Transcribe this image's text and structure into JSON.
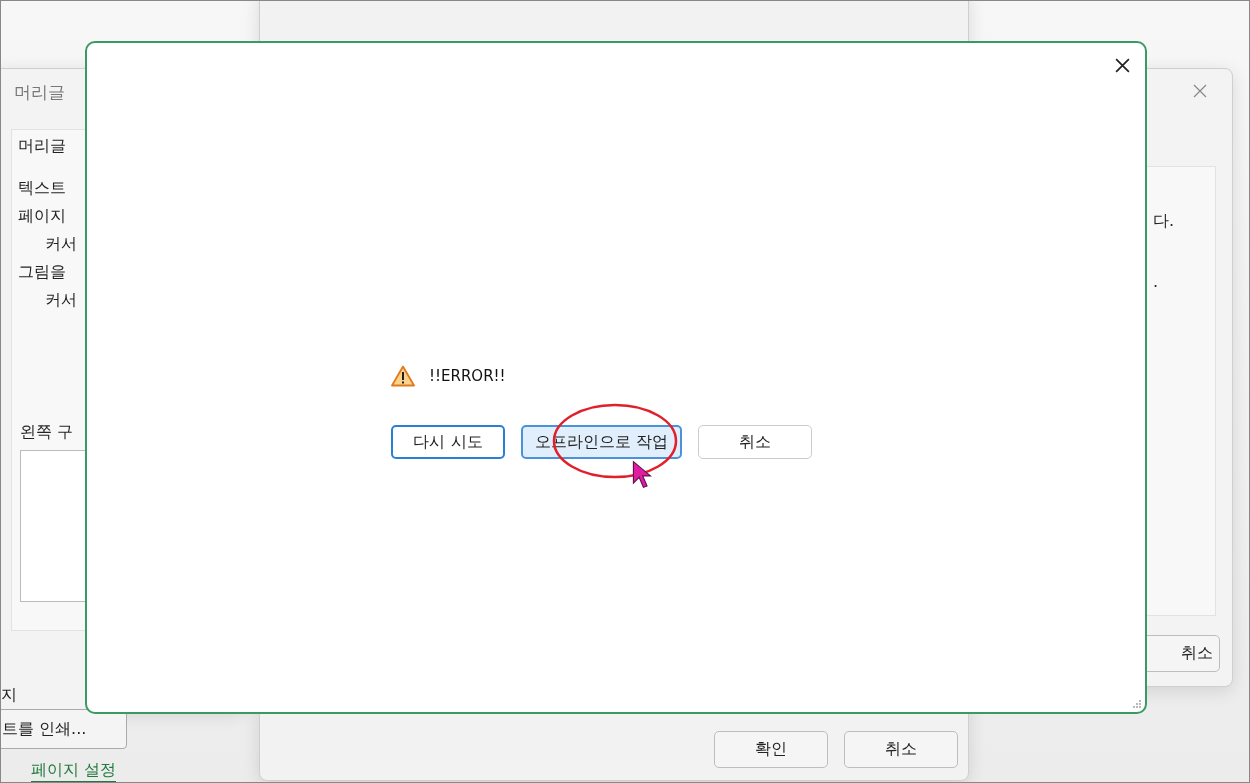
{
  "left_window": {
    "title": "머리글",
    "tab": "머리글",
    "items": [
      {
        "text": "텍스트"
      },
      {
        "text": "페이지",
        "children": [
          {
            "text": "커서"
          }
        ]
      },
      {
        "text": "그림을",
        "children": [
          {
            "text": "커서"
          }
        ]
      }
    ],
    "section_label": "왼쪽 구",
    "bottom_text": "지",
    "dropdown": "트를 인쇄...",
    "link": "페이지 설정"
  },
  "middle_window": {
    "buttons": [
      "확인",
      "취소"
    ]
  },
  "right_window": {
    "lines": [
      "다.",
      "."
    ],
    "button": "취소"
  },
  "dialog": {
    "message": "!!ERROR!!",
    "buttons": [
      {
        "label": "다시 시도",
        "kind": "default"
      },
      {
        "label": "오프라인으로 작업",
        "kind": "hovered"
      },
      {
        "label": "취소",
        "kind": "normal"
      }
    ]
  }
}
